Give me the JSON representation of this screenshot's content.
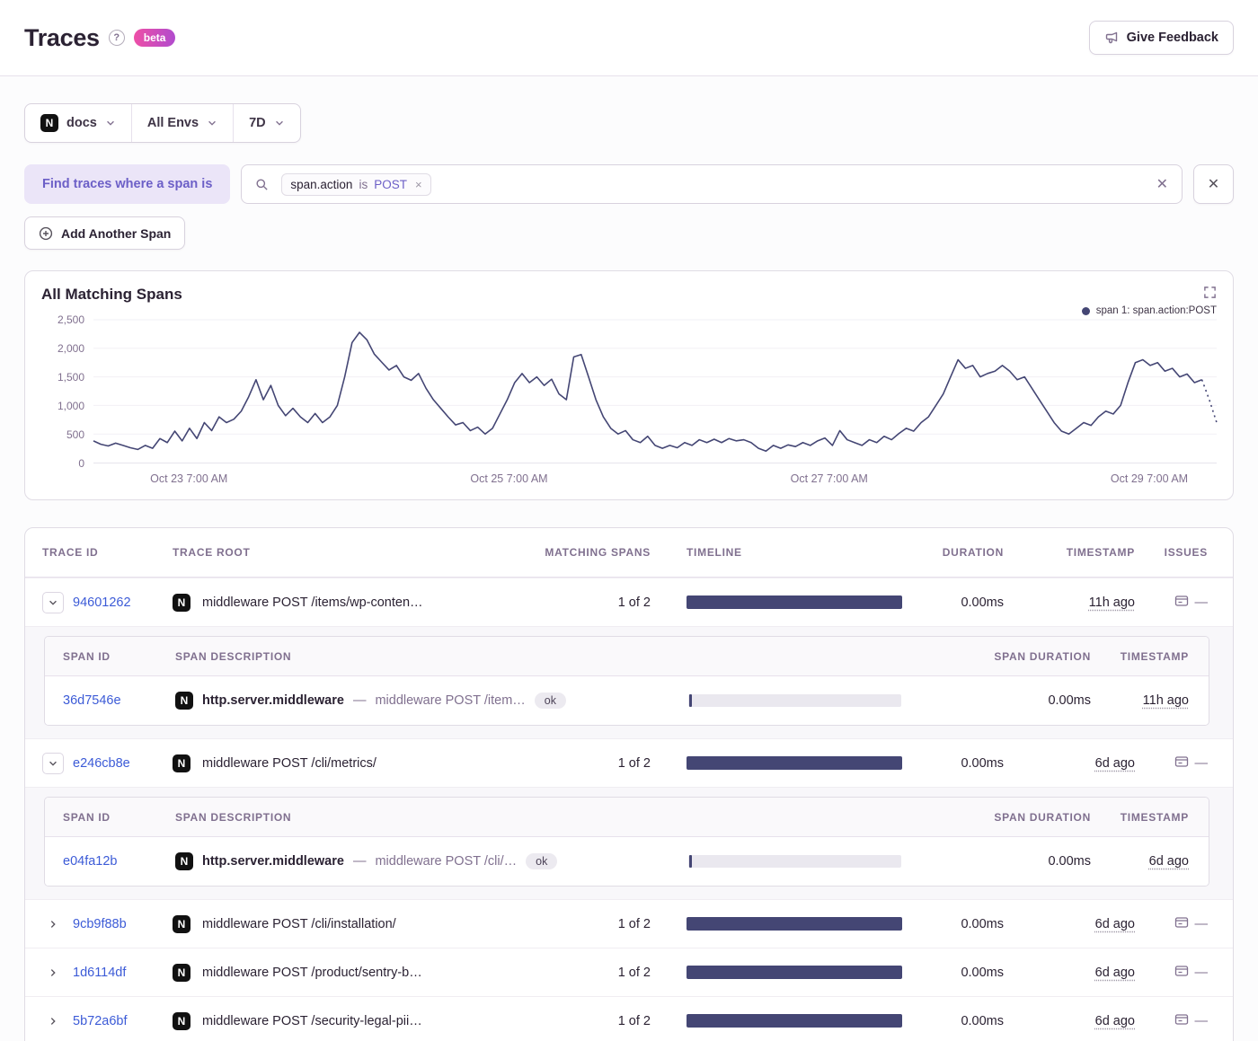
{
  "header": {
    "title": "Traces",
    "beta": "beta",
    "feedback_label": "Give Feedback"
  },
  "filters": {
    "project": "docs",
    "project_icon_letter": "N",
    "environment": "All Envs",
    "period": "7D"
  },
  "search": {
    "find_label": "Find traces where a span is",
    "token": {
      "key": "span.action",
      "op": "is",
      "value": "POST",
      "remove": "×"
    },
    "clear": "✕",
    "remove_filter": "✕",
    "add_span_label": "Add Another Span"
  },
  "chart_data": {
    "type": "line",
    "title": "All Matching Spans",
    "legend": [
      {
        "label": "span 1: span.action:POST",
        "color": "#444674"
      }
    ],
    "legend_position": "top-right",
    "grid": true,
    "ylim": [
      0,
      2500
    ],
    "y_ticks": [
      0,
      500,
      1000,
      1500,
      2000,
      2500
    ],
    "y_tick_labels": [
      "0",
      "500",
      "1,000",
      "1,500",
      "2,000",
      "2,500"
    ],
    "x_tick_labels": [
      "Oct 23 7:00 AM",
      "Oct 25 7:00 AM",
      "Oct 27 7:00 AM",
      "Oct 29 7:00 AM"
    ],
    "x_tick_fractions": [
      0.085,
      0.37,
      0.655,
      0.94
    ],
    "dashed_tail_points": 2,
    "series": [
      {
        "name": "span 1: span.action:POST",
        "color": "#444674",
        "values": [
          380,
          320,
          290,
          340,
          300,
          260,
          230,
          300,
          250,
          420,
          350,
          550,
          380,
          600,
          420,
          700,
          560,
          800,
          700,
          760,
          900,
          1150,
          1450,
          1100,
          1350,
          1000,
          820,
          950,
          800,
          700,
          860,
          700,
          800,
          1000,
          1500,
          2100,
          2280,
          2150,
          1900,
          1760,
          1620,
          1700,
          1500,
          1440,
          1560,
          1300,
          1100,
          950,
          800,
          660,
          700,
          560,
          620,
          500,
          600,
          850,
          1100,
          1400,
          1560,
          1400,
          1500,
          1350,
          1460,
          1200,
          1100,
          1850,
          1890,
          1500,
          1100,
          800,
          600,
          500,
          560,
          400,
          350,
          460,
          300,
          250,
          300,
          260,
          350,
          300,
          400,
          350,
          410,
          350,
          420,
          380,
          400,
          350,
          250,
          200,
          300,
          250,
          310,
          280,
          350,
          300,
          380,
          430,
          300,
          560,
          400,
          350,
          300,
          400,
          350,
          460,
          400,
          510,
          600,
          550,
          700,
          800,
          1000,
          1200,
          1500,
          1800,
          1650,
          1700,
          1500,
          1560,
          1600,
          1700,
          1600,
          1450,
          1500,
          1300,
          1100,
          900,
          700,
          550,
          500,
          600,
          700,
          650,
          800,
          900,
          850,
          1000,
          1400,
          1750,
          1800,
          1700,
          1750,
          1600,
          1650,
          1500,
          1550,
          1400,
          1450,
          1100,
          700
        ]
      }
    ]
  },
  "table": {
    "columns": [
      "TRACE ID",
      "TRACE ROOT",
      "MATCHING SPANS",
      "TIMELINE",
      "DURATION",
      "TIMESTAMP",
      "ISSUES"
    ],
    "span_columns": [
      "SPAN ID",
      "SPAN DESCRIPTION",
      "SPAN DURATION",
      "TIMESTAMP"
    ],
    "issues_empty": "—",
    "separator": "—",
    "rows": [
      {
        "trace_id": "94601262",
        "expanded": true,
        "root": "middleware POST /items/wp-conten…",
        "matching": "1 of 2",
        "duration": "0.00ms",
        "timestamp": "11h ago",
        "spans": [
          {
            "span_id": "36d7546e",
            "op": "http.server.middleware",
            "description": "middleware POST /item…",
            "status": "ok",
            "duration": "0.00ms",
            "timestamp": "11h ago"
          }
        ]
      },
      {
        "trace_id": "e246cb8e",
        "expanded": true,
        "root": "middleware POST /cli/metrics/",
        "matching": "1 of 2",
        "duration": "0.00ms",
        "timestamp": "6d ago",
        "spans": [
          {
            "span_id": "e04fa12b",
            "op": "http.server.middleware",
            "description": "middleware POST /cli/…",
            "status": "ok",
            "duration": "0.00ms",
            "timestamp": "6d ago"
          }
        ]
      },
      {
        "trace_id": "9cb9f88b",
        "expanded": false,
        "root": "middleware POST /cli/installation/",
        "matching": "1 of 2",
        "duration": "0.00ms",
        "timestamp": "6d ago",
        "spans": []
      },
      {
        "trace_id": "1d6114df",
        "expanded": false,
        "root": "middleware POST /product/sentry-b…",
        "matching": "1 of 2",
        "duration": "0.00ms",
        "timestamp": "6d ago",
        "spans": []
      },
      {
        "trace_id": "5b72a6bf",
        "expanded": false,
        "root": "middleware POST /security-legal-pii…",
        "matching": "1 of 2",
        "duration": "0.00ms",
        "timestamp": "6d ago",
        "spans": []
      }
    ]
  },
  "colors": {
    "accent_purple": "#6c5fc7",
    "link_blue": "#3c5bd7",
    "series_navy": "#444674",
    "border": "#e0dce5",
    "muted_text": "#80708f",
    "beta_gradient": [
      "#ef4fa6",
      "#b04bce"
    ]
  }
}
